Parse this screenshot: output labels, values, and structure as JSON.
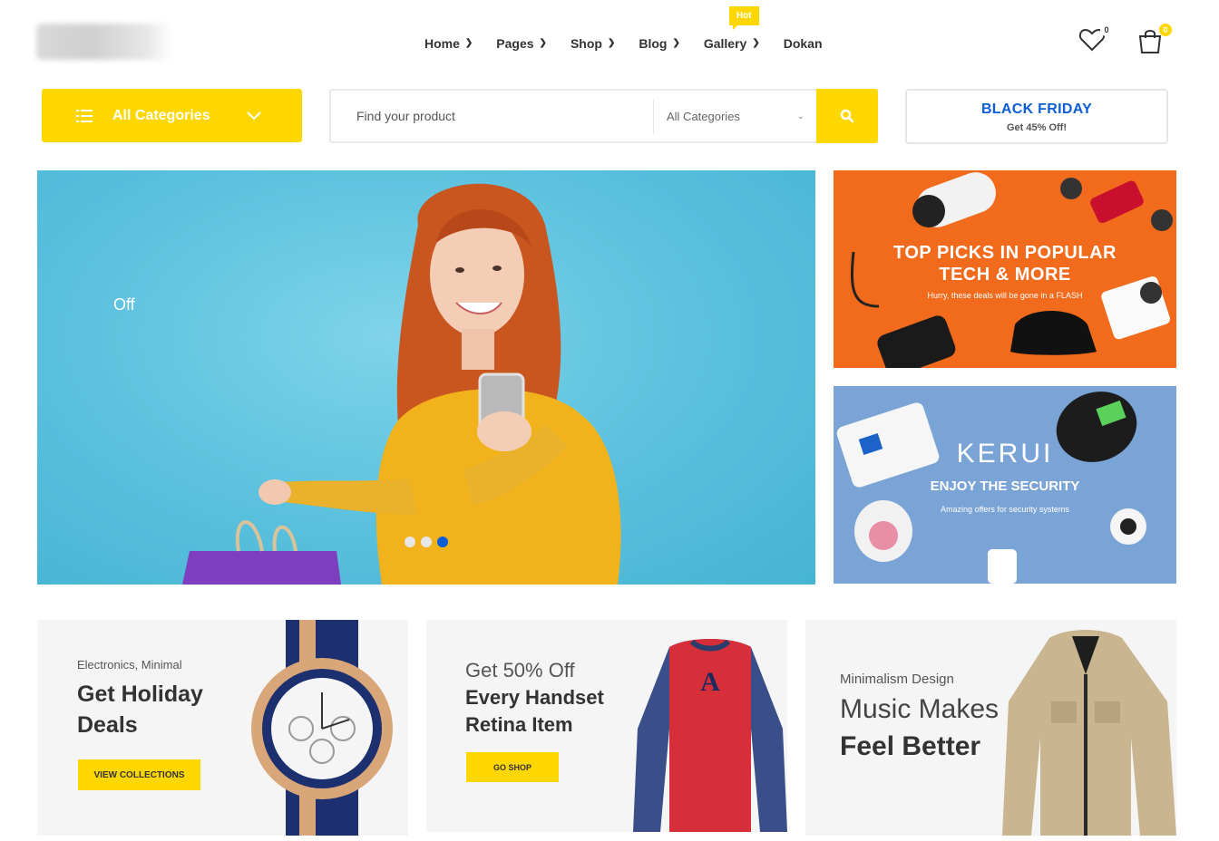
{
  "header": {
    "nav": [
      {
        "label": "Home",
        "has_dropdown": true
      },
      {
        "label": "Pages",
        "has_dropdown": true
      },
      {
        "label": "Shop",
        "has_dropdown": true
      },
      {
        "label": "Blog",
        "has_dropdown": true
      },
      {
        "label": "Gallery",
        "has_dropdown": true,
        "badge": "Hot"
      },
      {
        "label": "Dokan",
        "has_dropdown": false
      }
    ],
    "wishlist_count": "0",
    "cart_count": "0"
  },
  "toolbar": {
    "categories_label": "All Categories",
    "search_placeholder": "Find your product",
    "search_category": "All Categories",
    "promo_title": "BLACK FRIDAY",
    "promo_sub": "Get 45% Off!"
  },
  "hero": {
    "text": "Off",
    "slides": 3,
    "active_slide": 3
  },
  "side_banners": [
    {
      "title_line1": "TOP PICKS IN POPULAR",
      "title_line2": "TECH & MORE",
      "subtitle": "Hurry, these deals will be gone in a FLASH"
    },
    {
      "brand": "KERUI",
      "title": "ENJOY THE SECURITY",
      "subtitle": "Amazing offers for security systems"
    }
  ],
  "cards": [
    {
      "small": "Electronics, Minimal",
      "line1": "Get Holiday",
      "line2": "Deals",
      "button": "VIEW COLLECTIONS"
    },
    {
      "small": "Get 50% Off",
      "line1": "Every Handset",
      "line2": "Retina Item",
      "button": "GO SHOP"
    },
    {
      "small": "Minimalism Design",
      "line1": "Music Makes",
      "line2": "Feel Better"
    }
  ],
  "colors": {
    "accent": "#fed700",
    "link_blue": "#0b5ed7"
  }
}
